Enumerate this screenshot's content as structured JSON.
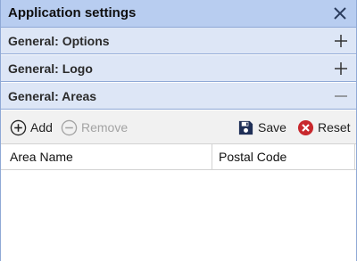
{
  "window": {
    "title": "Application settings",
    "close_icon": "close-icon"
  },
  "sections": [
    {
      "label": "General: Options",
      "state": "collapsed",
      "icon": "plus-icon"
    },
    {
      "label": "General: Logo",
      "state": "collapsed",
      "icon": "plus-icon"
    },
    {
      "label": "General: Areas",
      "state": "expanded",
      "icon": "minus-icon"
    }
  ],
  "toolbar": {
    "add_label": "Add",
    "remove_label": "Remove",
    "save_label": "Save",
    "reset_label": "Reset"
  },
  "grid": {
    "columns": [
      "Area Name",
      "Postal Code"
    ],
    "rows": []
  },
  "colors": {
    "titlebar": "#b8cdf0",
    "section": "#dde6f6",
    "border": "#8fa9d6",
    "reset_red": "#c8282d",
    "save_navy": "#1f2f57",
    "disabled_text": "#a3a3a3"
  }
}
